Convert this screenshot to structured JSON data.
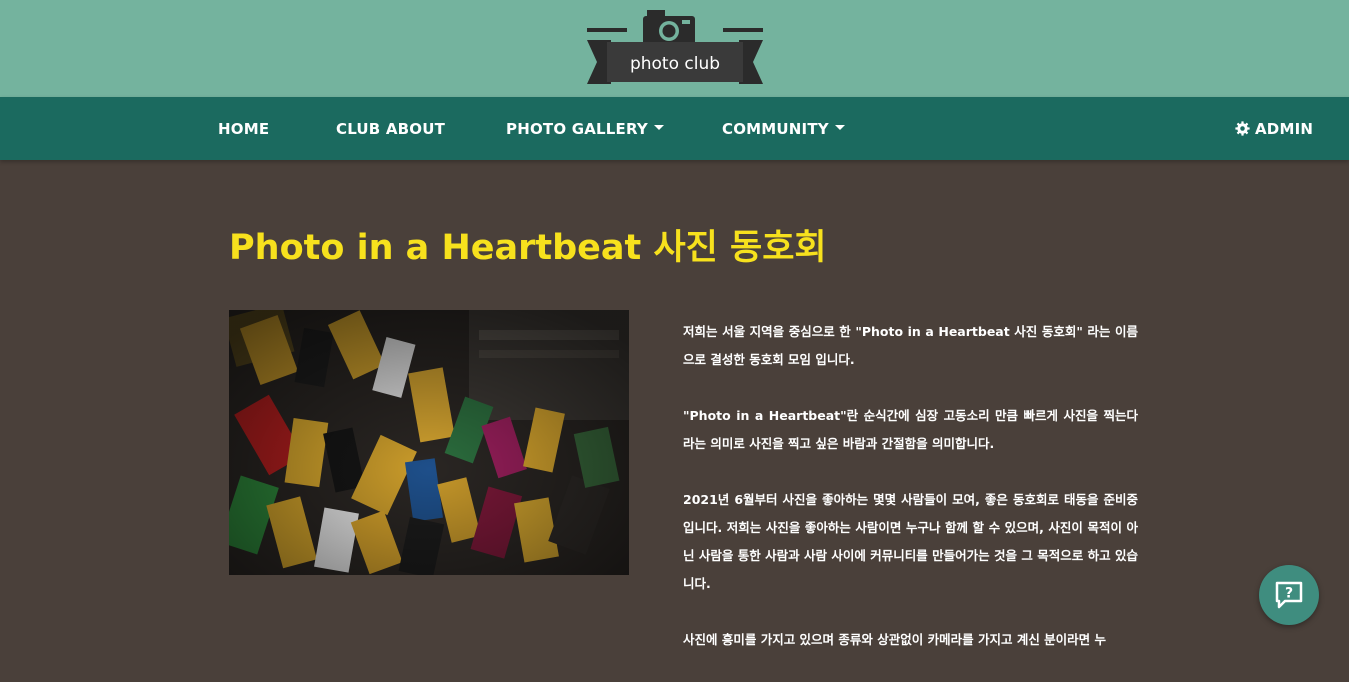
{
  "logo": {
    "text": "photo club",
    "icon": "camera-icon"
  },
  "nav": {
    "home": "HOME",
    "about": "CLUB ABOUT",
    "gallery": "PHOTO GALLERY",
    "community": "COMMUNITY",
    "admin": "ADMIN"
  },
  "main": {
    "title": "Photo in a Heartbeat 사진 동호회",
    "paragraphs": [
      "저희는 서울 지역을 중심으로 한 \"Photo in a Heartbeat 사진 동호회\" 라는 이름으로 결성한 동호회 모임 입니다.",
      "\"Photo in a Heartbeat\"란 순식간에 심장 고동소리 만큼 빠르게 사진을 찍는다라는 의미로 사진을 찍고 싶은 바람과 간절함을 의미합니다.",
      "2021년 6월부터 사진을 좋아하는 몇몇 사람들이 모여, 좋은 동호회로 태동을 준비중입니다. 저희는 사진을 좋아하는 사람이면 누구나 함께 할 수 있으며, 사진이 목적이 아닌 사람을 통한 사람과 사람 사이에 커뮤니티를 만들어가는 것을 그 목적으로 하고 있습니다.",
      "사진에 흥미를 가지고 있으며 종류와 상관없이 카메라를 가지고 계신 분이라면 누"
    ]
  },
  "colors": {
    "banner": "#74b39e",
    "nav": "#1b6a5f",
    "background": "#4a403a",
    "title": "#f7e11d"
  },
  "icons": {
    "admin": "gear-icon",
    "help": "help-chat-icon",
    "dropdown": "caret-down-icon"
  }
}
